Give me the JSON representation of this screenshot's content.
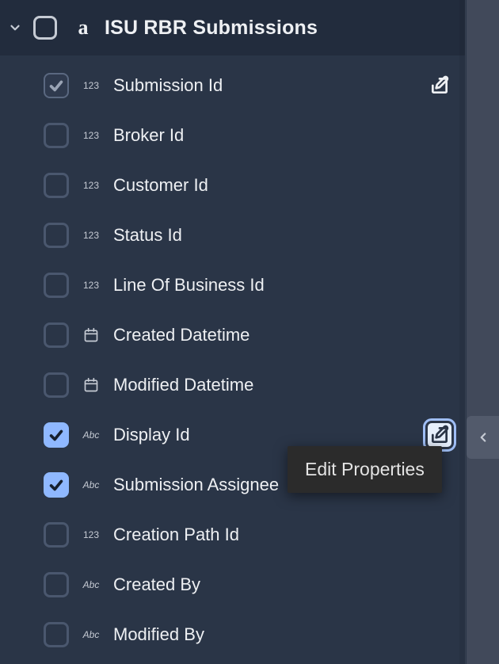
{
  "header": {
    "title": "ISU RBR Submissions"
  },
  "typeLabels": {
    "number": "123",
    "text": "Abc"
  },
  "fields": [
    {
      "id": "submission-id",
      "label": "Submission Id",
      "type": "number",
      "checked": "dim",
      "showEdit": true,
      "editFocused": false
    },
    {
      "id": "broker-id",
      "label": "Broker Id",
      "type": "number",
      "checked": "no",
      "showEdit": false,
      "editFocused": false
    },
    {
      "id": "customer-id",
      "label": "Customer Id",
      "type": "number",
      "checked": "no",
      "showEdit": false,
      "editFocused": false
    },
    {
      "id": "status-id",
      "label": "Status Id",
      "type": "number",
      "checked": "no",
      "showEdit": false,
      "editFocused": false
    },
    {
      "id": "line-of-business-id",
      "label": "Line Of Business Id",
      "type": "number",
      "checked": "no",
      "showEdit": false,
      "editFocused": false
    },
    {
      "id": "created-datetime",
      "label": "Created Datetime",
      "type": "date",
      "checked": "no",
      "showEdit": false,
      "editFocused": false
    },
    {
      "id": "modified-datetime",
      "label": "Modified Datetime",
      "type": "date",
      "checked": "no",
      "showEdit": false,
      "editFocused": false
    },
    {
      "id": "display-id",
      "label": "Display Id",
      "type": "text",
      "checked": "blue",
      "showEdit": true,
      "editFocused": true
    },
    {
      "id": "submission-assignee",
      "label": "Submission Assignee",
      "type": "text",
      "checked": "blue",
      "showEdit": false,
      "editFocused": false
    },
    {
      "id": "creation-path-id",
      "label": "Creation Path Id",
      "type": "number",
      "checked": "no",
      "showEdit": false,
      "editFocused": false
    },
    {
      "id": "created-by",
      "label": "Created By",
      "type": "text",
      "checked": "no",
      "showEdit": false,
      "editFocused": false
    },
    {
      "id": "modified-by",
      "label": "Modified By",
      "type": "text",
      "checked": "no",
      "showEdit": false,
      "editFocused": false
    }
  ],
  "tooltip": {
    "text": "Edit Properties"
  }
}
